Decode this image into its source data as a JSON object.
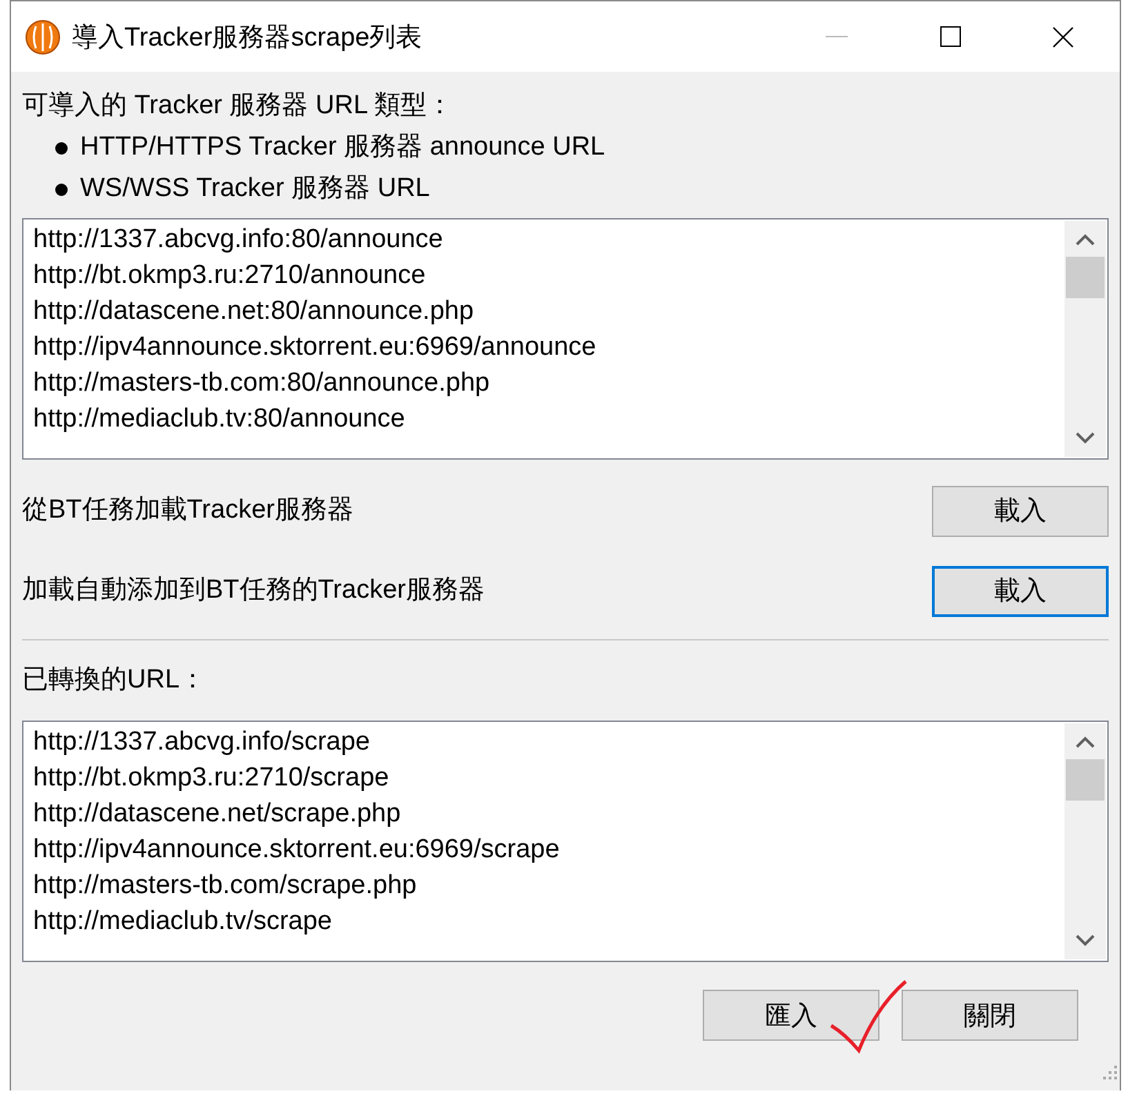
{
  "window": {
    "title": "導入Tracker服務器scrape列表"
  },
  "intro": {
    "label": "可導入的 Tracker 服務器 URL 類型：",
    "bullets": [
      "HTTP/HTTPS Tracker 服務器 announce URL",
      "WS/WSS Tracker 服務器 URL"
    ]
  },
  "source_urls": [
    "http://1337.abcvg.info:80/announce",
    "http://bt.okmp3.ru:2710/announce",
    "http://datascene.net:80/announce.php",
    "http://ipv4announce.sktorrent.eu:6969/announce",
    "http://masters-tb.com:80/announce.php",
    "http://mediaclub.tv:80/announce"
  ],
  "load_rows": [
    {
      "label": "從BT任務加載Tracker服務器",
      "button": "載入",
      "focused": false
    },
    {
      "label": "加載自動添加到BT任務的Tracker服務器",
      "button": "載入",
      "focused": true
    }
  ],
  "converted_label": "已轉換的URL：",
  "converted_urls": [
    "http://1337.abcvg.info/scrape",
    "http://bt.okmp3.ru:2710/scrape",
    "http://datascene.net/scrape.php",
    "http://ipv4announce.sktorrent.eu:6969/scrape",
    "http://masters-tb.com/scrape.php",
    "http://mediaclub.tv/scrape"
  ],
  "buttons": [
    {
      "label": "匯入"
    },
    {
      "label": "關閉"
    }
  ]
}
